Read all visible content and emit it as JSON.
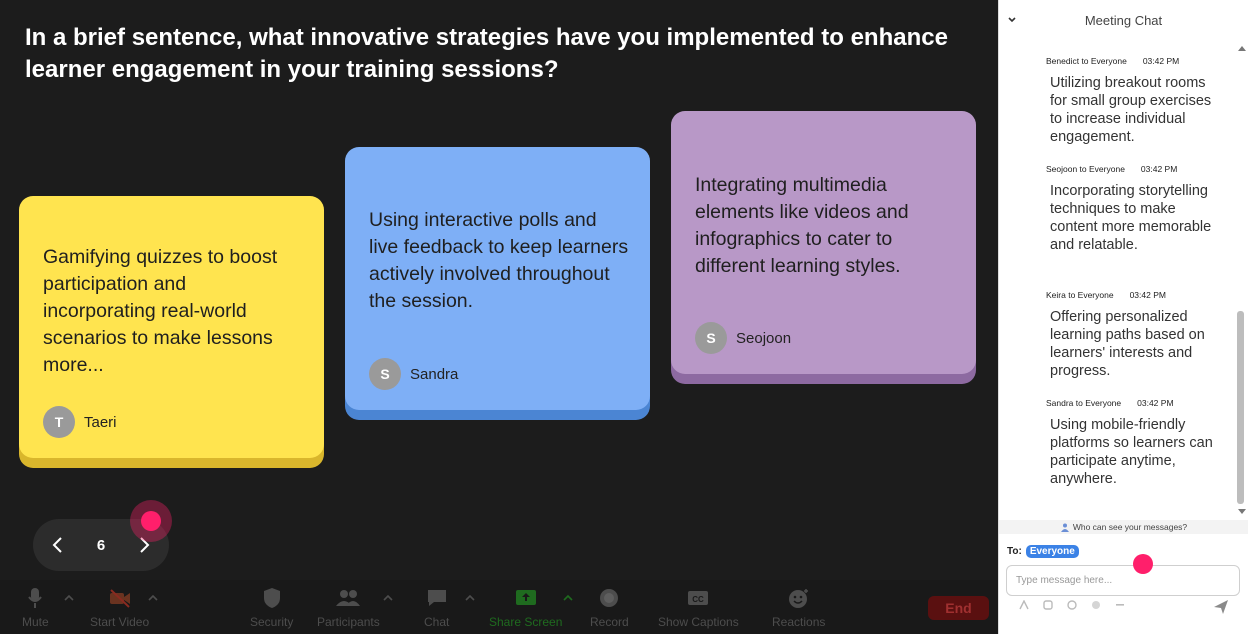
{
  "question": "In a brief sentence, what innovative strategies have you implemented to enhance learner engagement in your training sessions?",
  "cards": [
    {
      "text": "Gamifying quizzes to boost participation and incorporating real-world scenarios to make lessons more...",
      "initial": "T",
      "author": "Taeri",
      "color": "#ffe44f"
    },
    {
      "text": "Using interactive polls and live feedback to keep learners actively involved throughout the session.",
      "initial": "S",
      "author": "Sandra",
      "color": "#7eaff6"
    },
    {
      "text": "Integrating multimedia elements like videos and infographics to cater to different learning styles.",
      "initial": "S",
      "author": "Seojoon",
      "color": "#b898c7"
    }
  ],
  "pager": {
    "page": "6"
  },
  "toolbar": {
    "mute": "Mute",
    "start_video": "Start Video",
    "security": "Security",
    "participants": "Participants",
    "chat": "Chat",
    "share_screen": "Share Screen",
    "record": "Record",
    "show_captions": "Show Captions",
    "reactions": "Reactions",
    "end": "End"
  },
  "chat": {
    "title": "Meeting Chat",
    "messages": [
      {
        "from": "Benedict to Everyone",
        "time": "03:42 PM",
        "text": "Utilizing breakout rooms for small group exercises to increase individual engagement."
      },
      {
        "from": "Seojoon to Everyone",
        "time": "03:42 PM",
        "text": "Incorporating storytelling techniques to make content more memorable and relatable."
      },
      {
        "from": "Keira to Everyone",
        "time": "03:42 PM",
        "text": "Offering personalized learning paths based on learners' interests and progress."
      },
      {
        "from": "Sandra to Everyone",
        "time": "03:42 PM",
        "text": "Using mobile-friendly platforms so learners can participate anytime, anywhere."
      }
    ],
    "who_can_see": "Who can see your messages?",
    "to_label": "To:",
    "to_value": "Everyone",
    "input_placeholder": "Type message here..."
  },
  "colors": {
    "accent": "#ff1f6b",
    "to_pill": "#3b82e6",
    "end": "#5a1010"
  }
}
